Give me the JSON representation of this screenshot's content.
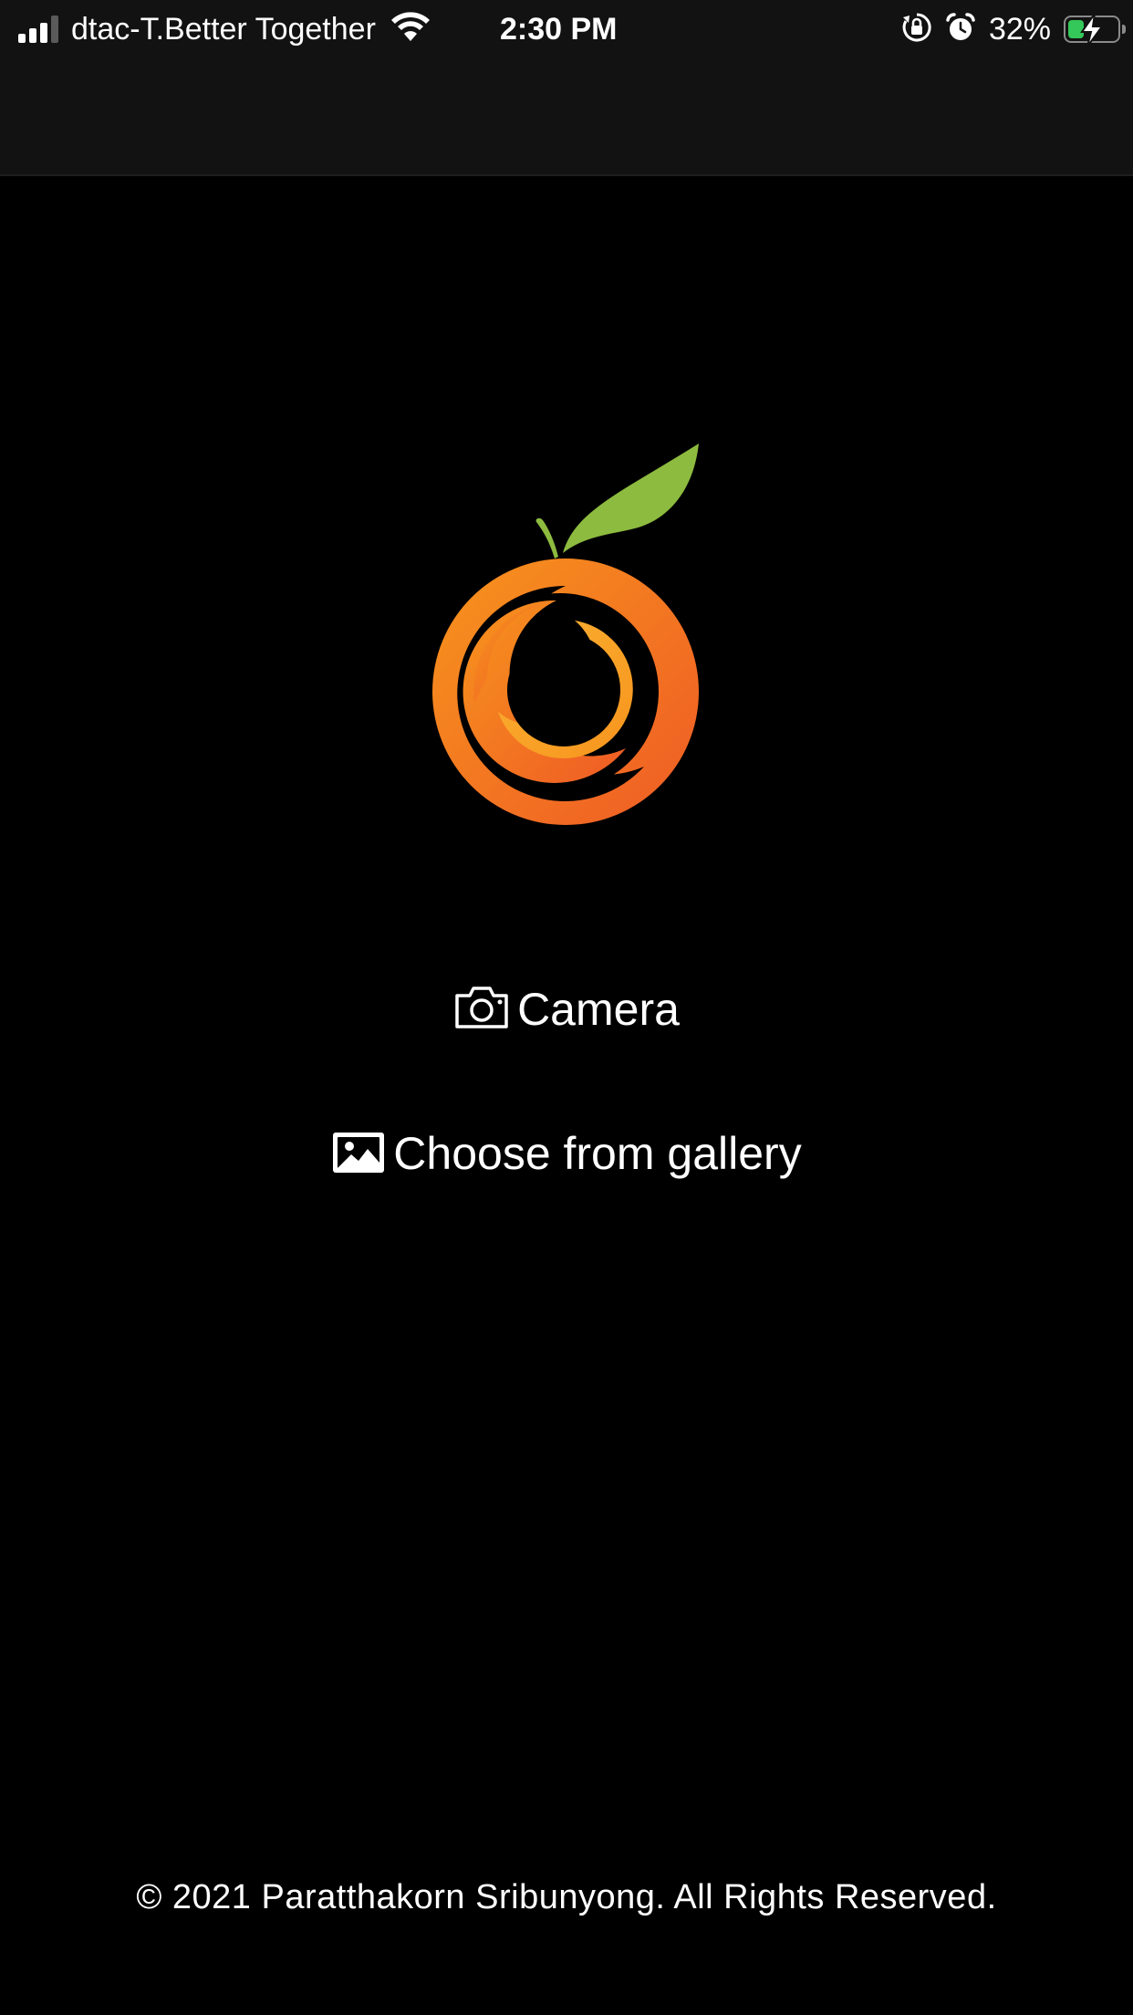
{
  "status_bar": {
    "carrier": "dtac-T.Better Together",
    "time": "2:30 PM",
    "battery_percent": "32%",
    "battery_level": 0.32,
    "icons": [
      "signal-icon",
      "wifi-icon",
      "orientation-lock-icon",
      "alarm-icon",
      "battery-charging-icon"
    ]
  },
  "logo": {
    "name": "orange-logo",
    "colors": {
      "leaf": "#8dbb3f",
      "stem": "#8dbb3f",
      "orange_outer": "#f26f21",
      "orange_inner": "#f7a823"
    }
  },
  "actions": {
    "camera_label": "Camera",
    "gallery_label": "Choose from gallery"
  },
  "footer": {
    "copyright": "© 2021 Paratthakorn Sribunyong. All Rights Reserved."
  },
  "colors": {
    "background": "#000000",
    "bar_background": "#121212",
    "text": "#ffffff",
    "battery_fill": "#34c759"
  }
}
